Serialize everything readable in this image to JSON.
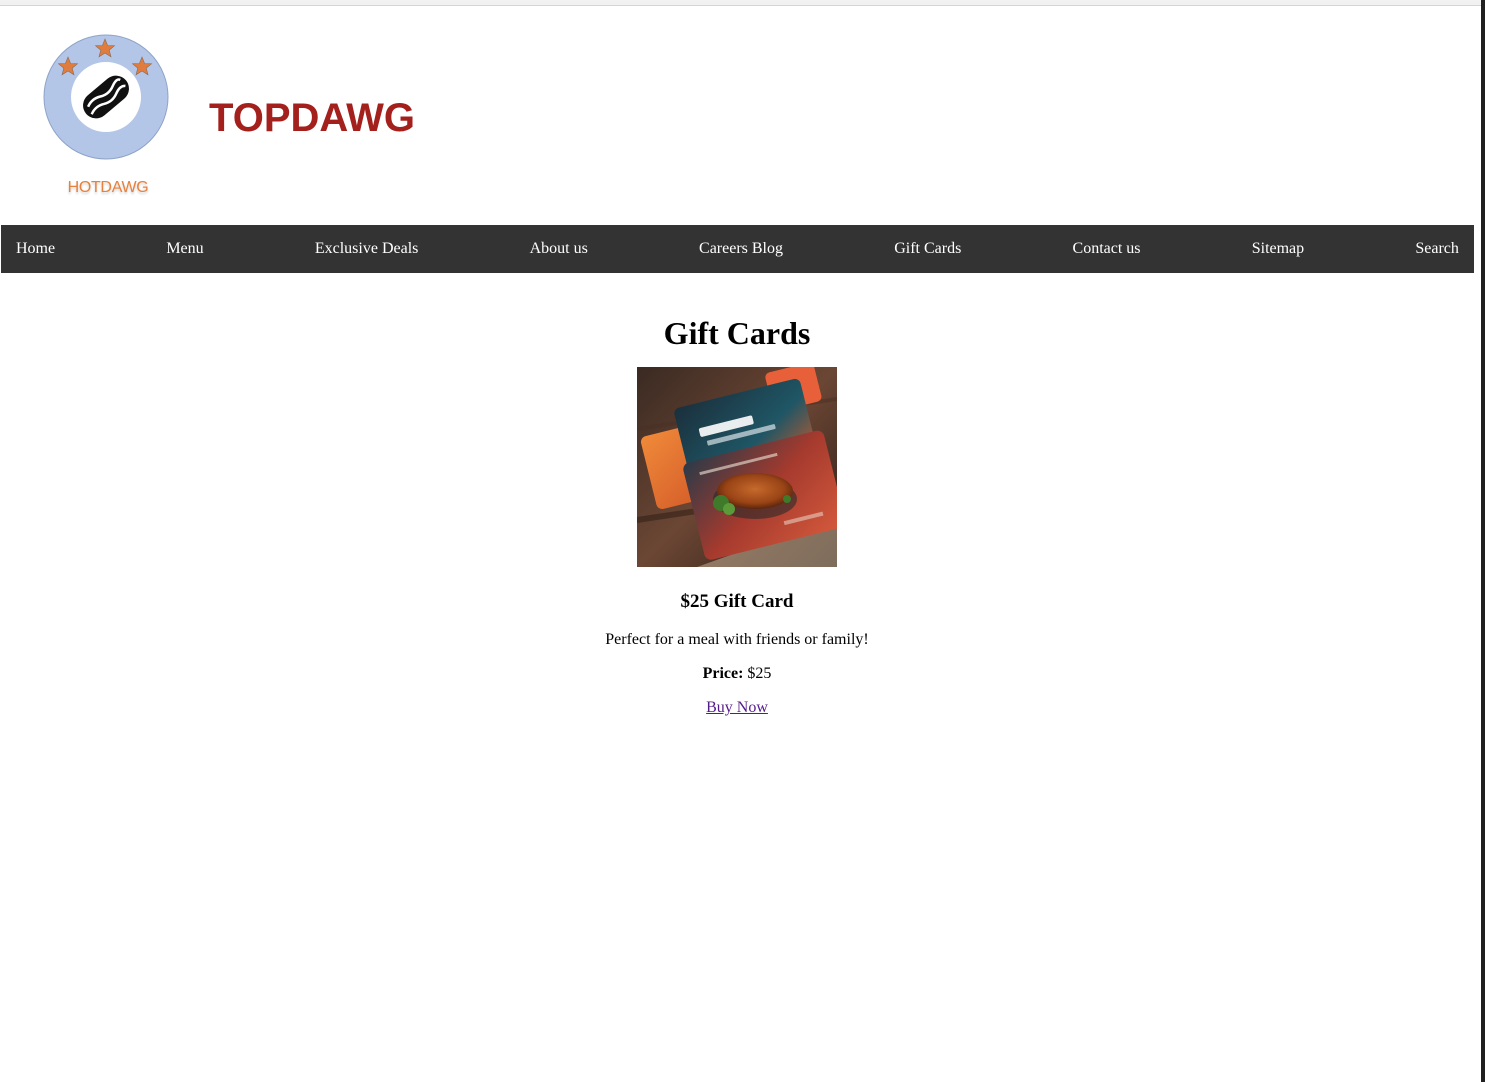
{
  "header": {
    "logo_text": "HOTDAWG",
    "brand_title": "TOPDAWG",
    "logo_icon": "hotdog-icon",
    "colors": {
      "brand_title": "#a4201d",
      "logo_circle": "#b3c6e7",
      "logo_stars": "#e07c3e",
      "logo_text": "#e8813c"
    }
  },
  "nav": {
    "background": "#333333",
    "items": [
      {
        "label": "Home"
      },
      {
        "label": "Menu"
      },
      {
        "label": "Exclusive Deals"
      },
      {
        "label": "About us"
      },
      {
        "label": "Careers Blog"
      },
      {
        "label": "Gift Cards"
      },
      {
        "label": "Contact us"
      },
      {
        "label": "Sitemap"
      },
      {
        "label": "Search"
      }
    ]
  },
  "main": {
    "heading": "Gift Cards",
    "card": {
      "title": "$25 Gift Card",
      "description": "Perfect for a meal with friends or family!",
      "price_label": "Price:",
      "price_value": "$25",
      "buy_label": "Buy Now",
      "image_name": "gift-card-image"
    }
  }
}
